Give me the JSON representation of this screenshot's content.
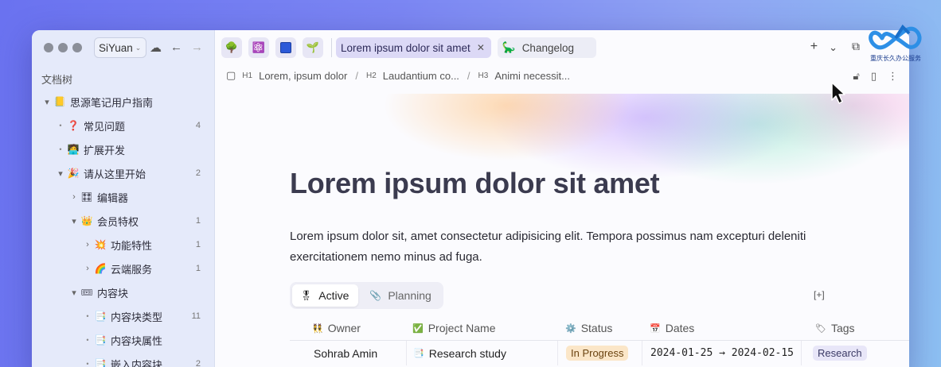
{
  "sidebar": {
    "workspace": "SiYuan",
    "tree_title": "文档树",
    "items": [
      {
        "label": "思源笔记用户指南",
        "emoji": "📒",
        "level": 0,
        "arrow": "▾",
        "count": ""
      },
      {
        "label": "常见问题",
        "emoji": "❓",
        "level": 1,
        "arrow": "•",
        "count": "4"
      },
      {
        "label": "扩展开发",
        "emoji": "🧑‍💻",
        "level": 1,
        "arrow": "•",
        "count": ""
      },
      {
        "label": "请从这里开始",
        "emoji": "🎉",
        "level": 1,
        "arrow": "▾",
        "count": "2"
      },
      {
        "label": "编辑器",
        "emoji": "🎛",
        "level": 2,
        "arrow": "›",
        "count": ""
      },
      {
        "label": "会员特权",
        "emoji": "👑",
        "level": 2,
        "arrow": "▾",
        "count": "1"
      },
      {
        "label": "功能特性",
        "emoji": "💥",
        "level": 3,
        "arrow": "›",
        "count": "1"
      },
      {
        "label": "云端服务",
        "emoji": "🌈",
        "level": 3,
        "arrow": "›",
        "count": "1"
      },
      {
        "label": "内容块",
        "emoji": "🎟",
        "level": 2,
        "arrow": "▾",
        "count": ""
      },
      {
        "label": "内容块类型",
        "emoji": "📑",
        "level": 3,
        "arrow": "•",
        "count": "11"
      },
      {
        "label": "内容块属性",
        "emoji": "📑",
        "level": 3,
        "arrow": "•",
        "count": ""
      },
      {
        "label": "嵌入内容块",
        "emoji": "📑",
        "level": 3,
        "arrow": "•",
        "count": "2"
      }
    ]
  },
  "tabs": {
    "dock_icons": [
      "🌳",
      "⚛️",
      "■",
      "🌱"
    ],
    "active": "Lorem ipsum dolor sit amet",
    "inactive": "Changelog",
    "inactive_emoji": "🦕"
  },
  "breadcrumb": [
    {
      "h": "H1",
      "text": "Lorem, ipsum dolor"
    },
    {
      "h": "H2",
      "text": "Laudantium co..."
    },
    {
      "h": "H3",
      "text": "Animi necessit..."
    }
  ],
  "doc": {
    "title": "Lorem ipsum dolor sit amet",
    "paragraph": "Lorem ipsum dolor sit, amet consectetur adipisicing elit. Tempora possimus nam excepturi deleniti exercitationem nemo minus ad fuga."
  },
  "database": {
    "views": [
      {
        "label": "Active",
        "emoji": "🎖"
      },
      {
        "label": "Planning",
        "emoji": "📎"
      }
    ],
    "columns": [
      {
        "label": "Owner",
        "emoji": "👯"
      },
      {
        "label": "Project Name",
        "emoji": "✅"
      },
      {
        "label": "Status",
        "emoji": "⚙️"
      },
      {
        "label": "Dates",
        "emoji": "📅"
      },
      {
        "label": "Tags",
        "emoji": "🏷"
      }
    ],
    "rows": [
      {
        "owner": "Sohrab Amin",
        "project": "Research study",
        "project_emoji": "📑",
        "status": "In Progress",
        "dates": "2024-01-25 → 2024-02-15",
        "tag": "Research"
      }
    ]
  },
  "logo": {
    "text": "重庆长久办公服务"
  },
  "colors": {
    "accent": "#dcd9f6",
    "status_pill": "#fbe6c8",
    "tag_pill": "#e8e6f8",
    "title": "#3b3b4f"
  }
}
